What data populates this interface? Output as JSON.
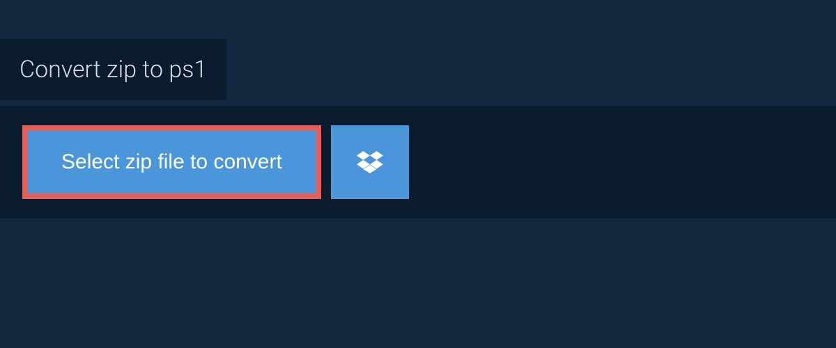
{
  "header": {
    "title": "Convert zip to ps1"
  },
  "actions": {
    "select_label": "Select zip file to convert"
  },
  "colors": {
    "background": "#13273f",
    "panel": "#0b1b2e",
    "button": "#4b95da",
    "highlight_border": "#e45f5a",
    "text_light": "#ffffff",
    "text_header": "#d8dde2"
  }
}
